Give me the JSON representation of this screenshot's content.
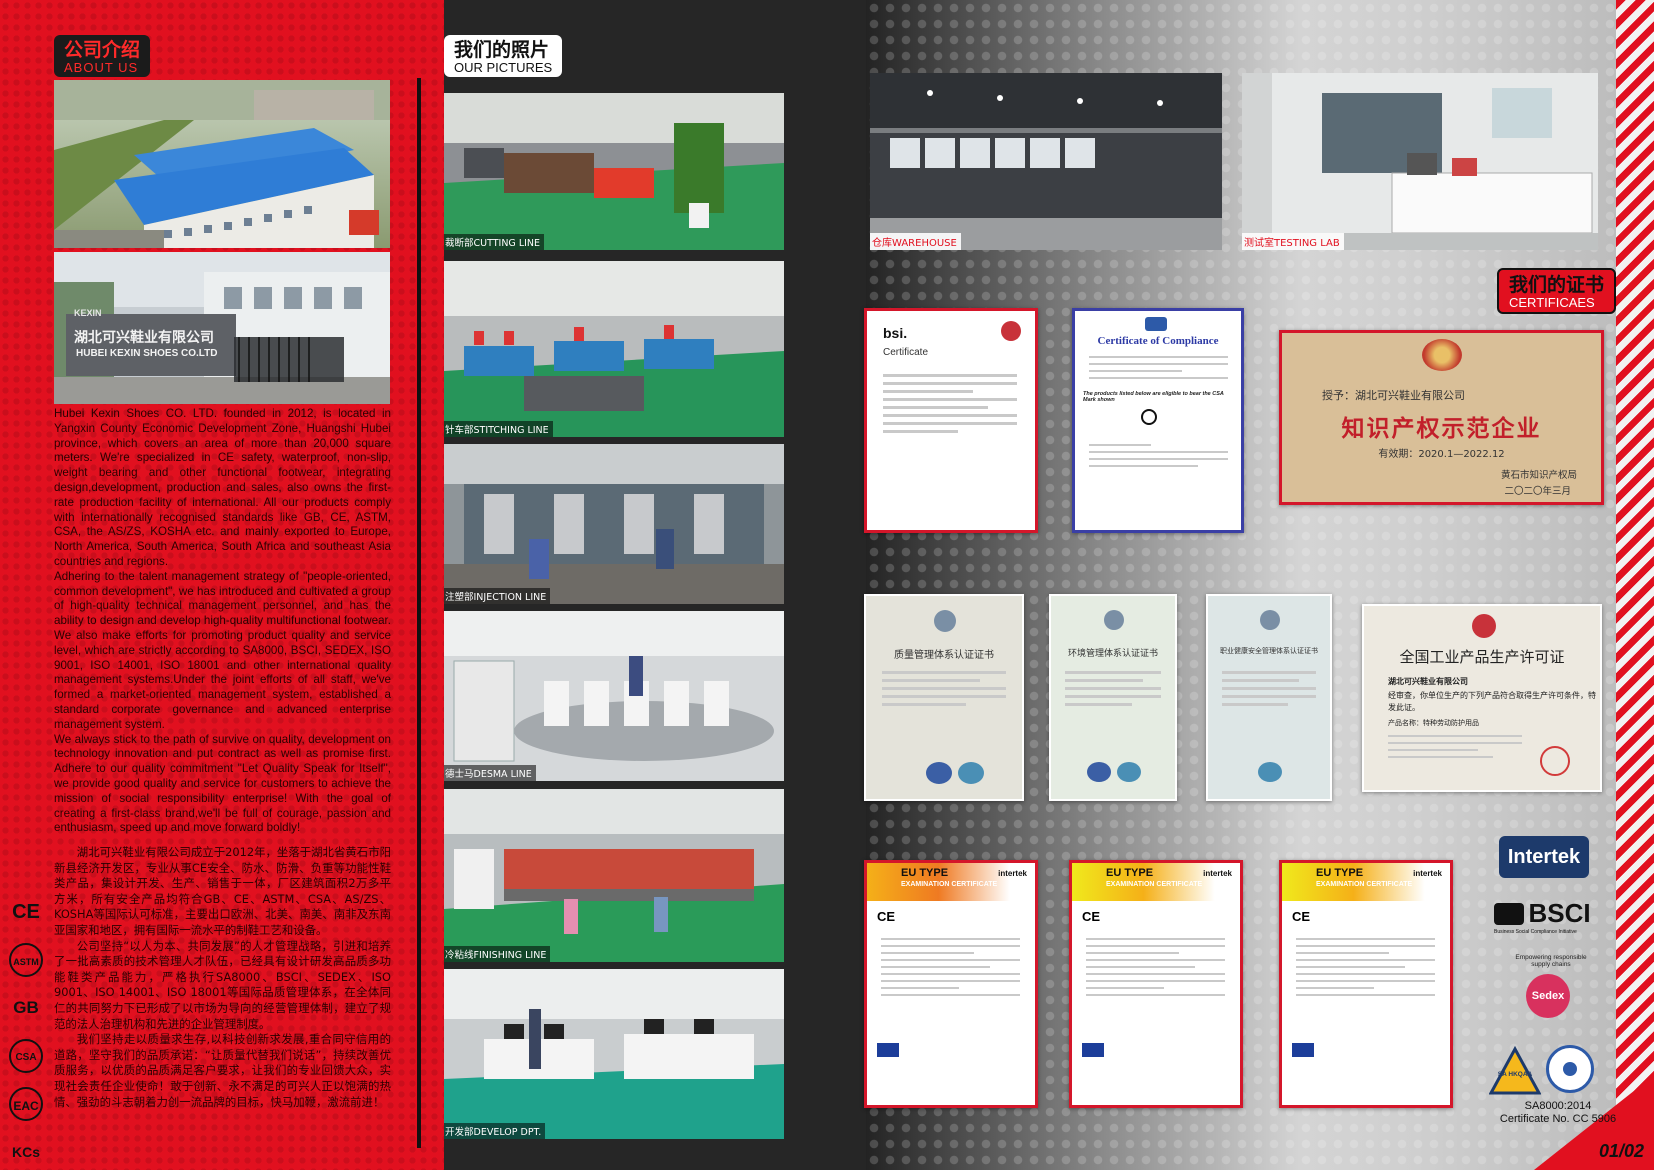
{
  "about": {
    "title_zh": "公司介绍",
    "title_en": "ABOUT  US",
    "building_sign": "湖北可兴鞋业有限公司",
    "building_sign_en": "HUBEI  KEXIN  SHOES  CO.LTD",
    "logo_text": "KEXIN",
    "en_paragraphs": [
      "Hubei Kexin Shoes CO. LTD. founded in 2012, is located in Yangxin County Economic Development Zone, Huangshi Hubei province, which covers an area of more than 20,000 square meters. We're specialized in CE safety, waterproof, non-slip, weight bearing and other functional footwear, integrating design,development, production and sales, also owns the first-rate production facility of international. All our products comply with internationally recognised standards like GB, CE, ASTM, CSA, the AS/ZS, KOSHA etc. and mainly exported to Europe, North America, South America, South Africa and southeast Asia countries and regions.",
      "Adhering to the talent management strategy of \"people-oriented, common development\", we has introduced and cultivated a group of high-quality technical management personnel, and has the ability to design and develop high-quality multifunctional footwear. We also make efforts for promoting product quality and service level, which are strictly according to SA8000, BSCI, SEDEX, ISO 9001, ISO 14001, ISO 18001 and other international quality management systems.Under the joint efforts of all staff, we've formed a market-oriented management system, established a standard corporate governance and advanced enterprise management system.",
      "We always stick to the path of survive on quality, development on technology innovation and put contract as well as promise first. Adhere to our quality commitment \"Let Quality Speak for Itself\", we provide good quality and service for customers to achieve the mission of social responsibility enterprise! With the goal of creating a first-class brand,we'll be full of courage, passion and enthusiasm, speed up and move forward boldly!"
    ],
    "cn_paragraphs": [
      "湖北可兴鞋业有限公司成立于2012年，坐落于湖北省黄石市阳新县经济开发区，专业从事CE安全、防水、防滑、负重等功能性鞋类产品，集设计开发、生产、销售于一体，厂区建筑面积2万多平方米，所有安全产品均符合GB、CE、ASTM、CSA、AS/ZS、KOSHA等国际认可标准，主要出口欧洲、北美、南美、南非及东南亚国家和地区，拥有国际一流水平的制鞋工艺和设备。",
      "公司坚持“以人为本、共同发展”的人才管理战略，引进和培养了一批高素质的技术管理人才队伍，已经具有设计研发高品质多功能鞋类产品能力，严格执行SA8000、BSCI、SEDEX、ISO 9001、ISO 14001、ISO 18001等国际品质管理体系，在全体同仁的共同努力下已形成了以市场为导向的经营管理体制，建立了规范的法人治理机构和先进的企业管理制度。",
      "我们坚持走以质量求生存,以科技创新求发展,重合同守信用的道路，坚守我们的品质承诺：“让质量代替我们说话”，持续改善优质服务，以优质的品质满足客户要求，让我们的专业回馈大众，实现社会责任企业使命！敢于创新、永不满足的可兴人正以饱满的热情、强劲的斗志朝着力创一流品牌的目标，快马加鞭，激流前进！"
    ],
    "side_icons": [
      "CE",
      "ASTM",
      "GB",
      "CSA",
      "EAC",
      "KCs"
    ]
  },
  "pictures": {
    "title_zh": "我们的照片",
    "title_en": "OUR PICTURES",
    "captions": [
      "裁断部CUTTING LINE",
      "针车部STITCHING LINE",
      "注塑部INJECTION LINE",
      "德士马DESMA LINE",
      "冷粘线FINISHING LINE",
      "开发部DEVELOP DPT."
    ],
    "warehouse_caption": "仓库WAREHOUSE",
    "lab_caption": "测试室TESTING LAB"
  },
  "certificates": {
    "title_zh": "我们的证书",
    "title_en": "CERTIFICAES",
    "bsi_logo": "bsi.",
    "bsi_title": "Certificate",
    "csa_title": "Certificate of Compliance",
    "csa_sub": "The products listed below are eligible to bear the CSA Mark shown",
    "plaque_line1": "授予：湖北可兴鞋业有限公司",
    "plaque_main": "知识产权示范企业",
    "plaque_valid": "有效期：2020.1—2022.12",
    "plaque_issuer": "黄石市知识产权局",
    "plaque_date": "二〇二〇年三月",
    "qms_title": "质量管理体系认证证书",
    "ems_title": "环境管理体系认证证书",
    "ohs_title": "职业健康安全管理体系认证证书",
    "license_title": "全国工业产品生产许可证",
    "license_company": "湖北可兴鞋业有限公司",
    "license_text": "经审查，你单位生产的下列产品符合取得生产许可条件，特发此证。",
    "license_product": "产品名称：特种劳动防护用品",
    "eu_title": "EU TYPE",
    "eu_sub": "EXAMINATION CERTIFICATE",
    "eu_brand": "intertek",
    "logos": [
      "Intertek",
      "BSCI",
      "Sedex",
      "SA HKQAA"
    ],
    "bsci_sub": "Business Social Compliance Initiative",
    "sedex_ring": "Empowering responsible supply chains",
    "sa_cert": "SA8000:2014",
    "sa_no": "Certificate No. CC 5906",
    "page": "01/02"
  },
  "colors": {
    "brand_red": "#e1101f",
    "dark": "#1b1b1b"
  }
}
